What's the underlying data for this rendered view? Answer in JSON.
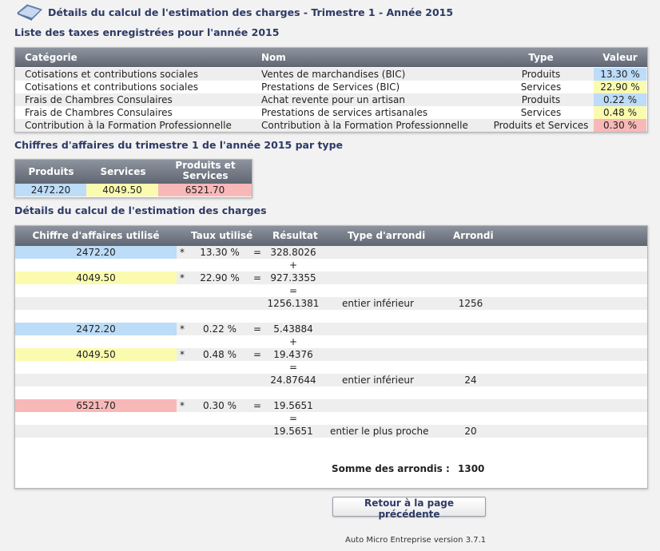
{
  "header": {
    "title": "Détails du calcul de l'estimation des charges - Trimestre 1 - Année 2015",
    "icon": "folder-icon"
  },
  "taxes_section": {
    "title": "Liste des taxes enregistrées pour l'année 2015",
    "columns": [
      "Catégorie",
      "Nom",
      "Type",
      "Valeur"
    ],
    "rows": [
      {
        "categorie": "Cotisations et contributions sociales",
        "nom": "Ventes de marchandises (BIC)",
        "type": "Produits",
        "valeur": "13.30 %",
        "color": "#bcdcf8"
      },
      {
        "categorie": "Cotisations et contributions sociales",
        "nom": "Prestations de Services (BIC)",
        "type": "Services",
        "valeur": "22.90 %",
        "color": "#fbfbaf"
      },
      {
        "categorie": "Frais de Chambres Consulaires",
        "nom": "Achat revente pour un artisan",
        "type": "Produits",
        "valeur": "0.22 %",
        "color": "#bcdcf8"
      },
      {
        "categorie": "Frais de Chambres Consulaires",
        "nom": "Prestations de services artisanales",
        "type": "Services",
        "valeur": "0.48 %",
        "color": "#fbfbaf"
      },
      {
        "categorie": "Contribution à la Formation Professionnelle",
        "nom": "Contribution à la Formation Professionnelle",
        "type": "Produits et Services",
        "valeur": "0.30 %",
        "color": "#f9b8b8"
      }
    ]
  },
  "ca_section": {
    "title": "Chiffres d'affaires du trimestre 1 de l'année 2015 par type",
    "columns": [
      "Produits",
      "Services",
      "Produits et Services"
    ],
    "values": [
      "2472.20",
      "4049.50",
      "6521.70"
    ]
  },
  "calc_section": {
    "title": "Détails du calcul de l'estimation des charges",
    "columns": [
      "Chiffre d'affaires utilisé",
      "Taux utilisé",
      "Résultat",
      "Type d'arrondi",
      "Arrondi"
    ],
    "groups": [
      {
        "lines": [
          {
            "ca": "2472.20",
            "op": "*",
            "taux": "13.30 %",
            "eq": "=",
            "resultat": "328.8026",
            "color": "blue"
          },
          {
            "sep": "+"
          },
          {
            "ca": "4049.50",
            "op": "*",
            "taux": "22.90 %",
            "eq": "=",
            "resultat": "927.3355",
            "color": "yellow"
          },
          {
            "sep": "="
          }
        ],
        "total": "1256.1381",
        "type_arrondi": "entier inférieur",
        "arrondi": "1256"
      },
      {
        "lines": [
          {
            "ca": "2472.20",
            "op": "*",
            "taux": "0.22 %",
            "eq": "=",
            "resultat": "5.43884",
            "color": "blue"
          },
          {
            "sep": "+"
          },
          {
            "ca": "4049.50",
            "op": "*",
            "taux": "0.48 %",
            "eq": "=",
            "resultat": "19.4376",
            "color": "yellow"
          },
          {
            "sep": "="
          }
        ],
        "total": "24.87644",
        "type_arrondi": "entier inférieur",
        "arrondi": "24"
      },
      {
        "lines": [
          {
            "ca": "6521.70",
            "op": "*",
            "taux": "0.30 %",
            "eq": "=",
            "resultat": "19.5651",
            "color": "pink"
          },
          {
            "sep": "="
          }
        ],
        "total": "19.5651",
        "type_arrondi": "entier le plus proche",
        "arrondi": "20"
      }
    ],
    "sum_label": "Somme des arrondis :",
    "sum_value": "1300"
  },
  "back_button": "Retour à la page précédente",
  "footer": "Auto Micro Entreprise version 3.7.1"
}
